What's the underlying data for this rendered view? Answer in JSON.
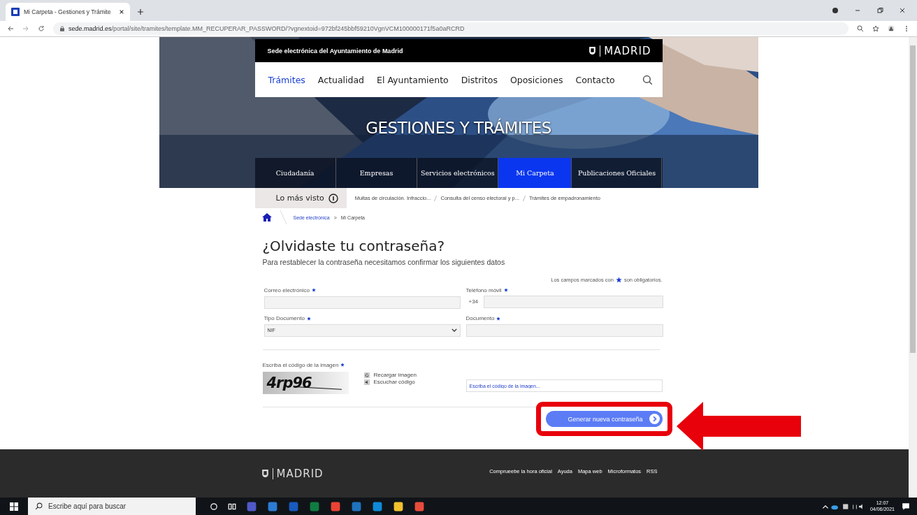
{
  "browser": {
    "tab_title": "Mi Carpeta - Gestiones y Trámite",
    "url_host": "sede.madrid.es",
    "url_path": "/portal/site/tramites/template.MM_RECUPERAR_PASSWORD/?vgnextoid=972bf245bbf59210VgnVCM100000171f5a0aRCRD"
  },
  "header": {
    "site_name": "Sede electrónica del Ayuntamiento de Madrid",
    "logo_text": "MADRID",
    "nav": [
      {
        "label": "Trámites",
        "selected": true
      },
      {
        "label": "Actualidad",
        "selected": false
      },
      {
        "label": "El Ayuntamiento",
        "selected": false
      },
      {
        "label": "Distritos",
        "selected": false
      },
      {
        "label": "Oposiciones",
        "selected": false
      },
      {
        "label": "Contacto",
        "selected": false
      }
    ],
    "banner_title": "GESTIONES Y TRÁMITES",
    "sections": [
      {
        "label": "Ciudadanía",
        "selected": false
      },
      {
        "label": "Empresas",
        "selected": false
      },
      {
        "label": "Servicios electrónicos",
        "selected": false
      },
      {
        "label": "Mi Carpeta",
        "selected": true
      },
      {
        "label": "Publicaciones Oficiales",
        "selected": false
      }
    ]
  },
  "most_viewed": {
    "label": "Lo más visto",
    "links": [
      "Multas de circulación. Infraccio...",
      "Consulta del censo electoral y p...",
      "Trámites de empadronamiento"
    ]
  },
  "breadcrumb": {
    "link": "Sede electrónica",
    "separator": ">",
    "current": "Mi Carpeta"
  },
  "form": {
    "title": "¿Olvidaste tu contraseña?",
    "subtitle": "Para restablecer la contraseña necesitamos confirmar los siguientes datos",
    "note_before": "Los campos marcados con",
    "note_after": "son obligatorios.",
    "fields": [
      {
        "kind": "text",
        "label": "Correo electrónico",
        "required": true
      },
      {
        "kind": "phone",
        "label": "Teléfono móvil",
        "required": true,
        "prefix": "+34"
      },
      {
        "kind": "select",
        "label": "Tipo Documento",
        "required": true,
        "value": "NIF"
      },
      {
        "kind": "text",
        "label": "Documento",
        "required": true
      }
    ],
    "captcha": {
      "label": "Escriba el código de la imagen",
      "required": true,
      "code": "4rp96",
      "reload": "Recargar imagen",
      "listen": "Escuchar código",
      "placeholder": "Escriba el código de la imagen..."
    },
    "submit": "Generar nueva contraseña"
  },
  "footer": {
    "logo_text": "MADRID",
    "links": [
      "Comprueebe la hora oficial",
      "Ayuda",
      "Mapa web",
      "Microformatos",
      "RSS"
    ]
  },
  "taskbar": {
    "search_placeholder": "Escribe aquí para buscar",
    "time": "12:07",
    "date": "04/06/2021"
  }
}
